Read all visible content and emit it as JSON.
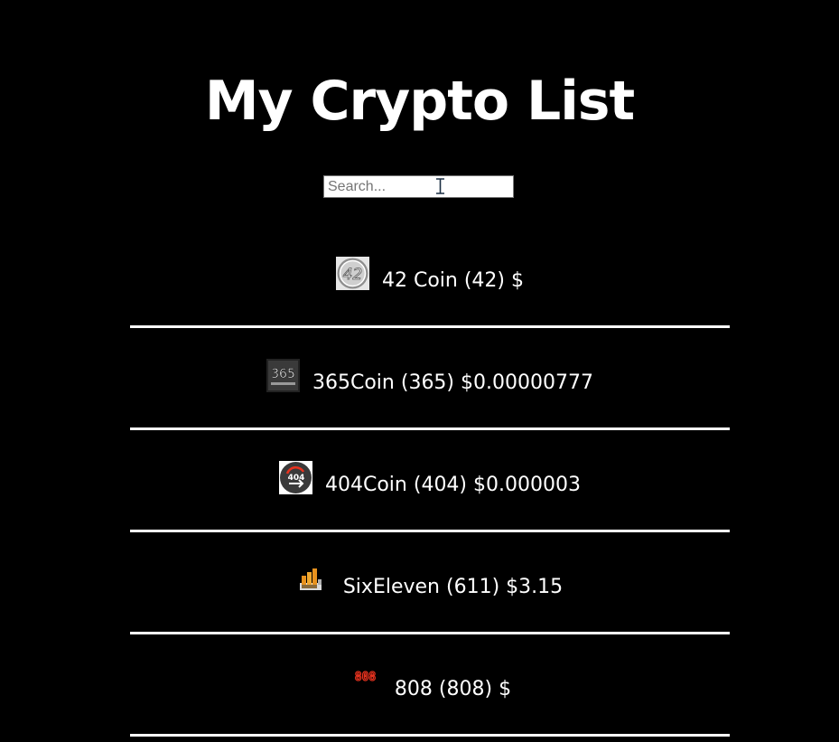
{
  "header": {
    "title": "My Crypto List"
  },
  "search": {
    "placeholder": "Search...",
    "value": ""
  },
  "coins": [
    {
      "name": "42 Coin",
      "symbol": "(42)",
      "price": "$",
      "logo_icon": "42-coin-logo-icon"
    },
    {
      "name": "365Coin",
      "symbol": "(365)",
      "price": "$0.00000777",
      "logo_icon": "365-coin-logo-icon"
    },
    {
      "name": "404Coin",
      "symbol": "(404)",
      "price": "$0.000003",
      "logo_icon": "404-coin-logo-icon"
    },
    {
      "name": "SixEleven",
      "symbol": "(611)",
      "price": "$3.15",
      "logo_icon": "sixeleven-logo-icon"
    },
    {
      "name": "808",
      "symbol": "(808)",
      "price": "$",
      "logo_icon": "808-logo-icon"
    }
  ],
  "logo_texts": {
    "coin_42": "42",
    "coin_365": "365",
    "coin_404": "404",
    "coin_808": "808"
  },
  "colors": {
    "background": "#000000",
    "text": "#ffffff",
    "divider": "#ffffff",
    "logo_808": "#e8321e"
  }
}
